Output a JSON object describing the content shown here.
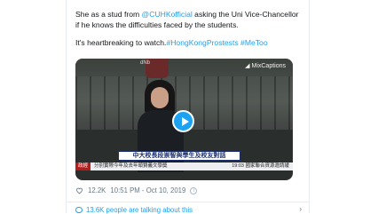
{
  "tweet": {
    "line1_pre": "She as a stud from ",
    "mention": "@CUHKofficial",
    "line1_post": " asking the Uni Vice-Chancellor if he knows the difficulties faced by the students.",
    "line2_pre": "It's heartbreaking to watch.",
    "hashtag1": "#HongKongProstests",
    "hashtag2": "#MeToo"
  },
  "video": {
    "watermark": "MixCaptions",
    "cam_logo": "dNb",
    "banner": "中大校長段崇智與學生及校友對話",
    "ticker_tag": "政經",
    "ticker_text": "分別實際今年及去年頒贊義文學獎",
    "ticker_right": "19:03 國家聯合資源邀請緩"
  },
  "meta": {
    "likes": "12.2K",
    "time": "10:51 PM - Oct 10, 2019"
  },
  "footer": {
    "talking": "13.6K people are talking about this"
  },
  "colors": {
    "link": "#1da1f2",
    "text": "#14171a",
    "muted": "#657786",
    "like": "#e0245e"
  },
  "icons": [
    "heart-icon",
    "info-icon",
    "play-icon",
    "comment-icon",
    "chevron-right-icon"
  ]
}
